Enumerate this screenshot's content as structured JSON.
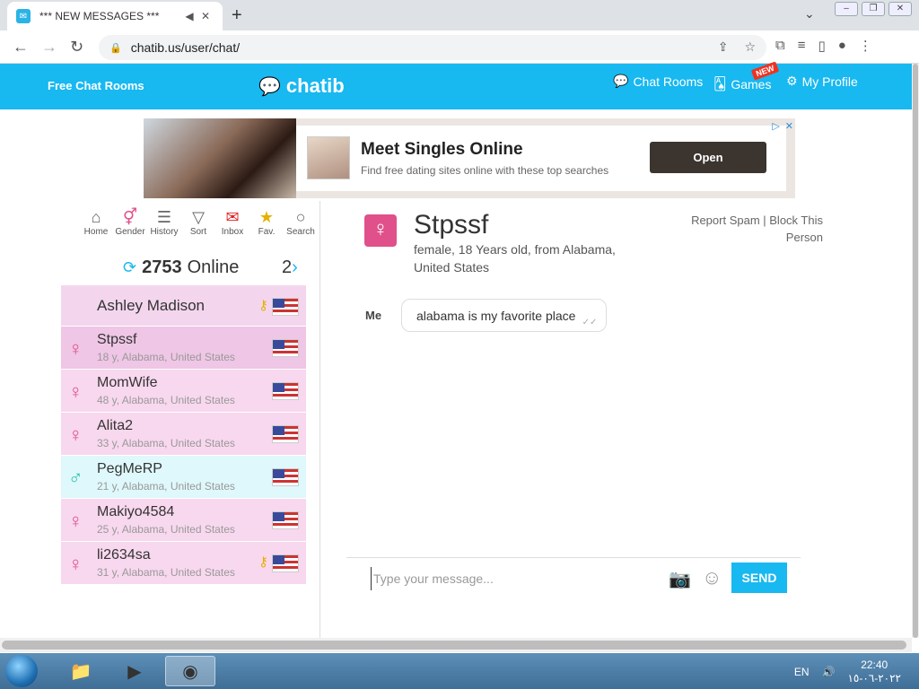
{
  "browser": {
    "tab_title": "*** NEW MESSAGES ***",
    "url": "chatib.us/user/chat/"
  },
  "header": {
    "free_chat": "Free Chat Rooms",
    "logo": "chatib",
    "chat_rooms": "Chat Rooms",
    "games": "Games",
    "new_badge": "NEW",
    "my_profile": "My Profile"
  },
  "ad": {
    "title": "Meet Singles Online",
    "subtitle": "Find free dating sites online with these top searches",
    "button": "Open"
  },
  "toolbar": [
    {
      "label": "Home",
      "icon": "home-icon"
    },
    {
      "label": "Gender",
      "icon": "gender-icon"
    },
    {
      "label": "History",
      "icon": "history-icon"
    },
    {
      "label": "Sort",
      "icon": "filter-icon"
    },
    {
      "label": "Inbox",
      "icon": "envelope-icon"
    },
    {
      "label": "Fav.",
      "icon": "star-icon"
    },
    {
      "label": "Search",
      "icon": "search-icon"
    }
  ],
  "online": {
    "count": "2753",
    "label": "Online",
    "page": "2"
  },
  "users": [
    {
      "name": "Ashley Madison",
      "sub": ""
    },
    {
      "name": "Stpssf",
      "sub": "18 y, Alabama, United States"
    },
    {
      "name": "MomWife",
      "sub": "48 y, Alabama, United States"
    },
    {
      "name": "Alita2",
      "sub": "33 y, Alabama, United States"
    },
    {
      "name": "PegMeRP",
      "sub": "21 y, Alabama, United States"
    },
    {
      "name": "Makiyo4584",
      "sub": "25 y, Alabama, United States"
    },
    {
      "name": "li2634sa",
      "sub": "31 y, Alabama, United States"
    }
  ],
  "profile": {
    "name": "Stpssf",
    "info": "female, 18 Years old, from Alabama, United States",
    "report": "Report Spam",
    "block": "Block This Person"
  },
  "chat": {
    "me_label": "Me",
    "message": "alabama is my favorite place",
    "input_placeholder": "Type your message...",
    "send": "SEND"
  },
  "taskbar": {
    "lang": "EN",
    "time": "22:40",
    "date": "٢٠٢٢-٠٦-١٥"
  },
  "colors": {
    "brand": "#18b8f0",
    "female": "#e0508a",
    "male": "#2cc3b0"
  }
}
